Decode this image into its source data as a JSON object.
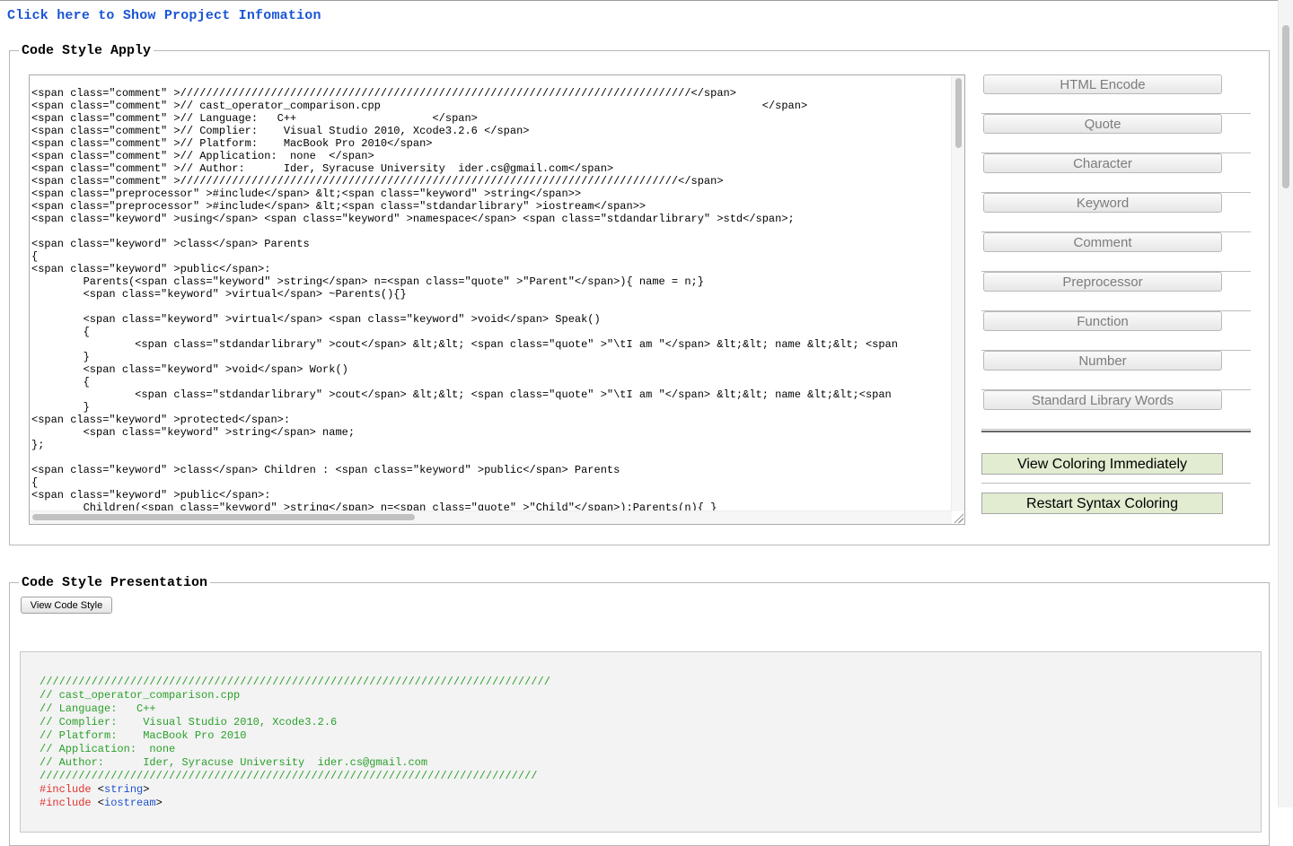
{
  "header": {
    "project_link": "Click here to Show Propject Infomation"
  },
  "apply": {
    "legend": "Code Style Apply",
    "code_lines": [
      "<span class=\"comment\" >///////////////////////////////////////////////////////////////////////////////</span>",
      "<span class=\"comment\" >// cast_operator_comparison.cpp                                                           </span>",
      "<span class=\"comment\" >// Language:   C++                     </span>",
      "<span class=\"comment\" >// Complier:    Visual Studio 2010, Xcode3.2.6 </span>",
      "<span class=\"comment\" >// Platform:    MacBook Pro 2010</span>",
      "<span class=\"comment\" >// Application:  none  </span>",
      "<span class=\"comment\" >// Author:      Ider, Syracuse University  ider.cs@gmail.com</span>",
      "<span class=\"comment\" >/////////////////////////////////////////////////////////////////////////////</span>",
      "<span class=\"preprocessor\" >#include</span> &lt;<span class=\"keyword\" >string</span>>",
      "<span class=\"preprocessor\" >#include</span> &lt;<span class=\"stdandarlibrary\" >iostream</span>>",
      "<span class=\"keyword\" >using</span> <span class=\"keyword\" >namespace</span> <span class=\"stdandarlibrary\" >std</span>;",
      "",
      "<span class=\"keyword\" >class</span> Parents",
      "{",
      "<span class=\"keyword\" >public</span>:",
      "        Parents(<span class=\"keyword\" >string</span> n=<span class=\"quote\" >\"Parent\"</span>){ name = n;}",
      "        <span class=\"keyword\" >virtual</span> ~Parents(){}",
      "",
      "        <span class=\"keyword\" >virtual</span> <span class=\"keyword\" >void</span> Speak()",
      "        {",
      "                <span class=\"stdandarlibrary\" >cout</span> &lt;&lt; <span class=\"quote\" >\"\\tI am \"</span> &lt;&lt; name &lt;&lt; <span",
      "        }",
      "        <span class=\"keyword\" >void</span> Work()",
      "        {",
      "                <span class=\"stdandarlibrary\" >cout</span> &lt;&lt; <span class=\"quote\" >\"\\tI am \"</span> &lt;&lt; name &lt;&lt;<span",
      "        }",
      "<span class=\"keyword\" >protected</span>:",
      "        <span class=\"keyword\" >string</span> name;",
      "};",
      "",
      "<span class=\"keyword\" >class</span> Children : <span class=\"keyword\" >public</span> Parents",
      "{",
      "<span class=\"keyword\" >public</span>:",
      "        Children(<span class=\"keyword\" >string</span> n=<span class=\"quote\" >\"Child\"</span>):Parents(n){ }"
    ],
    "style_buttons": [
      "HTML Encode",
      "Quote",
      "Character",
      "Keyword",
      "Comment",
      "Preprocessor",
      "Function",
      "Number",
      "Standard Library Words"
    ],
    "view_now_label": "View Coloring Immediately",
    "restart_label": "Restart Syntax Coloring"
  },
  "presentation": {
    "legend": "Code Style Presentation",
    "view_button": "View Code Style",
    "lines": [
      [
        {
          "t": "///////////////////////////////////////////////////////////////////////////////",
          "c": "comment"
        }
      ],
      [
        {
          "t": "// cast_operator_comparison.cpp",
          "c": "comment"
        }
      ],
      [
        {
          "t": "// Language:   C++",
          "c": "comment"
        }
      ],
      [
        {
          "t": "// Complier:    Visual Studio 2010, Xcode3.2.6",
          "c": "comment"
        }
      ],
      [
        {
          "t": "// Platform:    MacBook Pro 2010",
          "c": "comment"
        }
      ],
      [
        {
          "t": "// Application:  none",
          "c": "comment"
        }
      ],
      [
        {
          "t": "// Author:      Ider, Syracuse University  ider.cs@gmail.com",
          "c": "comment"
        }
      ],
      [
        {
          "t": "/////////////////////////////////////////////////////////////////////////////",
          "c": "comment"
        }
      ],
      [
        {
          "t": "#include",
          "c": "pre"
        },
        {
          "t": " <",
          "c": "blk"
        },
        {
          "t": "string",
          "c": "blue"
        },
        {
          "t": ">",
          "c": "blk"
        }
      ],
      [
        {
          "t": "#include",
          "c": "pre"
        },
        {
          "t": " <",
          "c": "blk"
        },
        {
          "t": "iostream",
          "c": "blue"
        },
        {
          "t": ">",
          "c": "blk"
        }
      ]
    ]
  }
}
